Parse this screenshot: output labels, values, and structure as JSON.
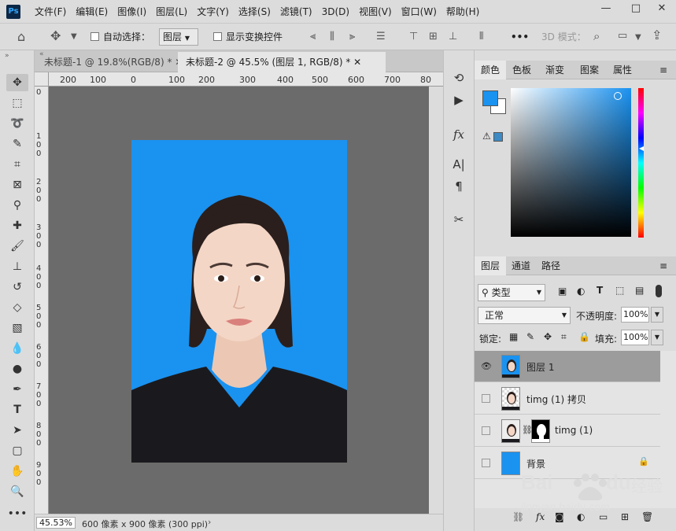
{
  "app": {
    "logo": "Ps"
  },
  "menu": [
    "文件(F)",
    "编辑(E)",
    "图像(I)",
    "图层(L)",
    "文字(Y)",
    "选择(S)",
    "滤镜(T)",
    "3D(D)",
    "视图(V)",
    "窗口(W)",
    "帮助(H)"
  ],
  "window_controls": {
    "minimize": "—",
    "maximize": "□",
    "close": "✕"
  },
  "options": {
    "auto_select_label": "自动选择：",
    "auto_select_value": "图层",
    "show_transform_label": "显示变换控件",
    "mode_3d_label": "3D 模式：",
    "more": "•••"
  },
  "tabs": [
    {
      "label": "未标题-1 @ 19.8%(RGB/8) *",
      "close": "✕"
    },
    {
      "label": "未标题-2 @ 45.5% (图层 1, RGB/8) *",
      "close": "✕"
    }
  ],
  "ruler_h": [
    "200",
    "100",
    "0",
    "100",
    "200",
    "300",
    "400",
    "500",
    "600",
    "700",
    "80"
  ],
  "ruler_v": [
    "0",
    "1 0 0",
    "2 0 0",
    "3 0 0",
    "4 0 0",
    "5 0 0",
    "6 0 0",
    "7 0 0",
    "8 0 0",
    "9 0 0"
  ],
  "status": {
    "zoom": "45.53%",
    "info": "600 像素 x 900 像素 (300 ppi)",
    "arrow": "›"
  },
  "color_panel": {
    "tabs": [
      "颜色",
      "色板",
      "渐变",
      "图案",
      "属性"
    ],
    "foreground": "#1a92f0",
    "background": "#ffffff"
  },
  "layers_panel": {
    "tabs": [
      "图层",
      "通道",
      "路径"
    ],
    "filter_label": "类型",
    "blend_mode": "正常",
    "opacity_label": "不透明度:",
    "opacity_value": "100%",
    "lock_label": "锁定:",
    "fill_label": "填充:",
    "fill_value": "100%",
    "layers": [
      {
        "name": "图层 1",
        "visible": true,
        "selected": true
      },
      {
        "name": "timg (1) 拷贝",
        "visible": false,
        "selected": false
      },
      {
        "name": "timg (1)",
        "visible": false,
        "selected": false
      },
      {
        "name": "背景",
        "visible": false,
        "selected": false
      }
    ]
  },
  "watermark": {
    "brand": "Bai",
    "brand2": "du",
    "text": "经验",
    "url": "jingyan.baidu.com"
  }
}
